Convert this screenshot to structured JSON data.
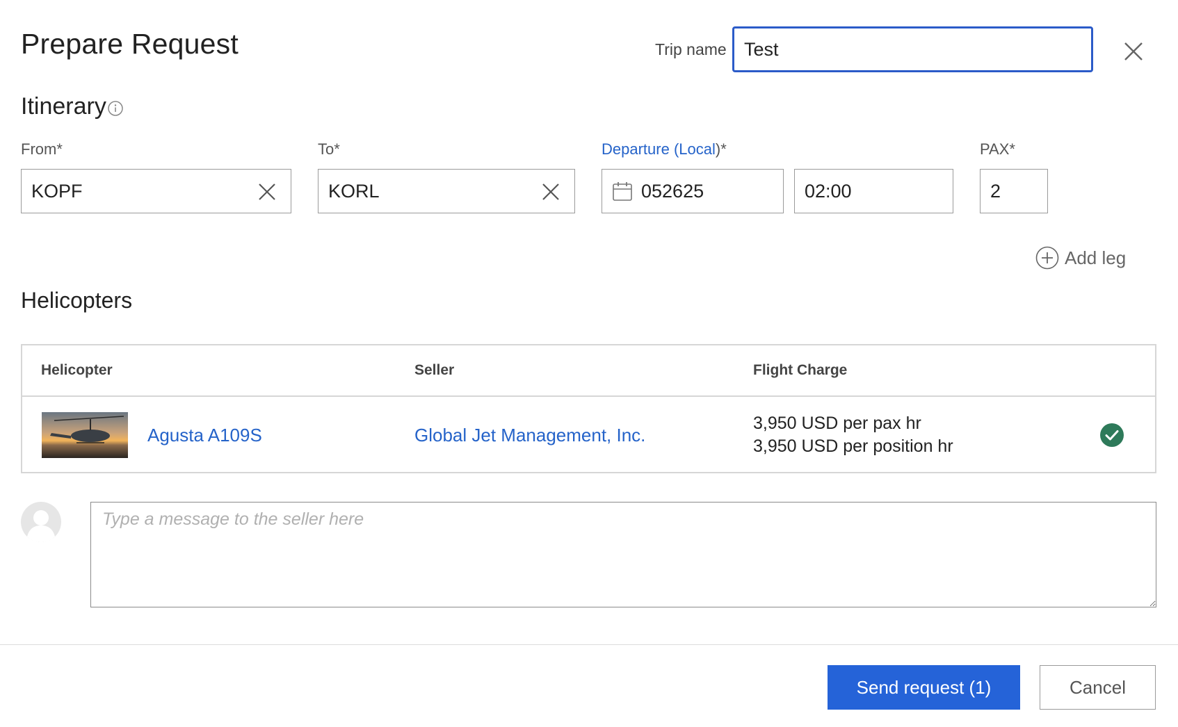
{
  "dialog": {
    "title": "Prepare Request",
    "trip_name_label": "Trip name",
    "trip_name_value": "Test"
  },
  "itinerary": {
    "title": "Itinerary",
    "from_label": "From*",
    "from_value": "KOPF",
    "to_label": "To*",
    "to_value": "KORL",
    "departure_label": "Departure",
    "departure_local": "Local",
    "departure_open": " (",
    "departure_close": ")*",
    "date_value": "052625",
    "time_value": "02:00",
    "pax_label": "PAX*",
    "pax_value": "2",
    "add_leg": "Add leg"
  },
  "helicopters": {
    "title": "Helicopters",
    "columns": [
      "Helicopter",
      "Seller",
      "Flight Charge"
    ],
    "rows": [
      {
        "helicopter": "Agusta A109S",
        "seller": "Global Jet Management, Inc.",
        "charge_line1": "3,950 USD per pax hr",
        "charge_line2": "3,950 USD per position hr",
        "selected": true
      }
    ]
  },
  "message": {
    "placeholder": "Type a message to the seller here",
    "value": ""
  },
  "actions": {
    "send": "Send request (1)",
    "cancel": "Cancel"
  },
  "colors": {
    "accent": "#2563d8",
    "link": "#2563c9",
    "check": "#2e7a5a"
  },
  "icons": {
    "close": "close-icon",
    "info": "info-icon",
    "clear": "clear-icon",
    "calendar": "calendar-icon",
    "add": "plus-circle-icon",
    "check": "check-circle-icon",
    "avatar": "user-avatar-icon"
  }
}
